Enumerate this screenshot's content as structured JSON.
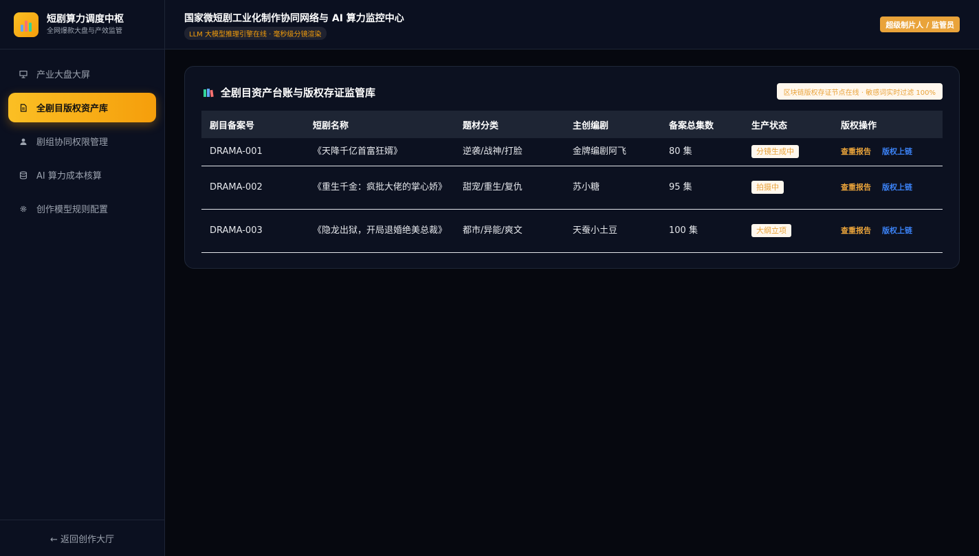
{
  "brand": {
    "title": "短剧算力调度中枢",
    "subtitle": "全网爆款大盘与产效监管"
  },
  "nav": {
    "items": [
      {
        "label": "产业大盘大屏",
        "icon": "presentation-icon"
      },
      {
        "label": "全剧目版权资产库",
        "icon": "document-icon"
      },
      {
        "label": "剧组协同权限管理",
        "icon": "user-icon"
      },
      {
        "label": "AI 算力成本核算",
        "icon": "database-icon"
      },
      {
        "label": "创作模型规则配置",
        "icon": "gear-icon"
      }
    ],
    "active_index": 1
  },
  "sidebar_footer": {
    "back_label": "← 返回创作大厅"
  },
  "header": {
    "title": "国家微短剧工业化制作协同网络与 AI 算力监控中心",
    "badge": "LLM 大模型推理引擎在线 · 毫秒级分镜渲染",
    "user_role": "超级制片人 / 监管员"
  },
  "card": {
    "icon": "books-icon",
    "title": "全剧目资产台账与版权存证监管库",
    "tag": "区块链版权存证节点在线 · 敏感词实时过滤 100%"
  },
  "table": {
    "columns": [
      "剧目备案号",
      "短剧名称",
      "题材分类",
      "主创编剧",
      "备案总集数",
      "生产状态",
      "版权操作"
    ],
    "rows": [
      {
        "id": "DRAMA-001",
        "name": "《天降千亿首富狂婿》",
        "genre": "逆袭/战神/打脸",
        "writer": "金牌编剧阿飞",
        "episodes": "80 集",
        "status": "分镜生成中",
        "report": "查重报告",
        "chain": "版权上链"
      },
      {
        "id": "DRAMA-002",
        "name": "《重生千金：疯批大佬的掌心娇》",
        "genre": "甜宠/重生/复仇",
        "writer": "苏小糖",
        "episodes": "95 集",
        "status": "拍摄中",
        "report": "查重报告",
        "chain": "版权上链"
      },
      {
        "id": "DRAMA-003",
        "name": "《隐龙出狱，开局退婚绝美总裁》",
        "genre": "都市/异能/爽文",
        "writer": "天蚕小土豆",
        "episodes": "100 集",
        "status": "大纲立项",
        "report": "查重报告",
        "chain": "版权上链"
      }
    ]
  },
  "colors": {
    "accent": "#f59e0b",
    "background": "#06080f",
    "panel": "#0b1020",
    "link_blue": "#3b82f6"
  }
}
